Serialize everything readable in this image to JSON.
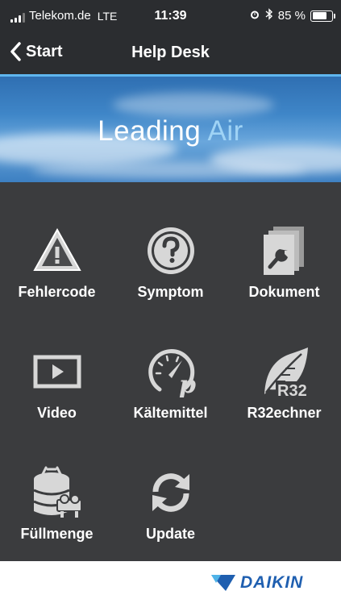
{
  "status_bar": {
    "carrier": "Telekom.de",
    "network": "LTE",
    "time": "11:39",
    "battery": "85 %",
    "battery_level": 0.85
  },
  "nav": {
    "back_label": "Start",
    "title": "Help Desk"
  },
  "banner": {
    "text_leading": "Leading",
    "text_air": "Air"
  },
  "menu": {
    "items": [
      {
        "label": "Fehlercode",
        "icon": "warning-triangle-icon"
      },
      {
        "label": "Symptom",
        "icon": "question-circle-icon"
      },
      {
        "label": "Dokument",
        "icon": "document-wrench-icon"
      },
      {
        "label": "Video",
        "icon": "video-play-icon"
      },
      {
        "label": "Kältemittel",
        "icon": "pressure-gauge-icon"
      },
      {
        "label": "R32echner",
        "icon": "r32-leaf-icon"
      },
      {
        "label": "Füllmenge",
        "icon": "refrigerant-cylinder-icon"
      },
      {
        "label": "Update",
        "icon": "refresh-icon"
      }
    ]
  },
  "footer": {
    "logo_text": "DAIKIN"
  },
  "colors": {
    "bar_bg": "#2b2d30",
    "menu_bg": "#3b3c3e",
    "brand_blue": "#1f5fb0",
    "banner_accent": "#5fb6ef"
  }
}
